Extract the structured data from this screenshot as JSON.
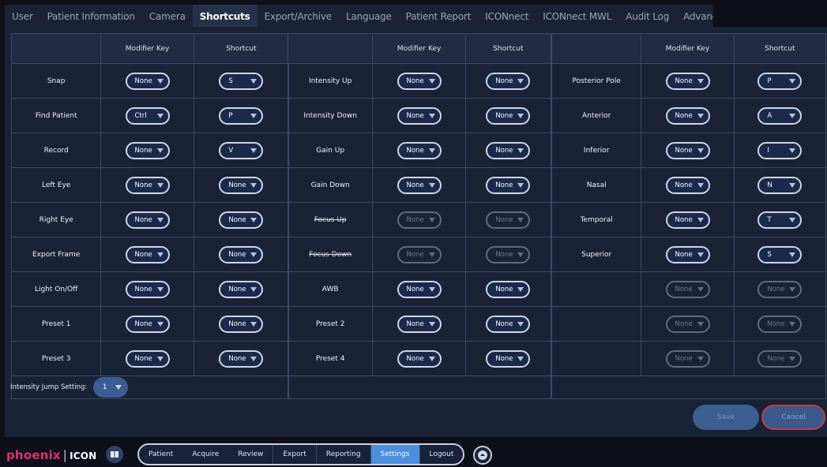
{
  "tabs": [
    {
      "label": "User"
    },
    {
      "label": "Patient Information"
    },
    {
      "label": "Camera"
    },
    {
      "label": "Shortcuts",
      "active": true
    },
    {
      "label": "Export/Archive"
    },
    {
      "label": "Language"
    },
    {
      "label": "Patient Report"
    },
    {
      "label": "ICONnect"
    },
    {
      "label": "ICONnect MWL"
    },
    {
      "label": "Audit Log"
    },
    {
      "label": "Advanced Settings"
    }
  ],
  "headers": {
    "modifier": "Modifier Key",
    "shortcut": "Shortcut"
  },
  "sections": [
    {
      "rows": [
        {
          "name": "Snap",
          "modifier": "None",
          "shortcut": "S"
        },
        {
          "name": "Find Patient",
          "modifier": "Ctrl",
          "shortcut": "P"
        },
        {
          "name": "Record",
          "modifier": "None",
          "shortcut": "V"
        },
        {
          "name": "Left Eye",
          "modifier": "None",
          "shortcut": "None"
        },
        {
          "name": "Right Eye",
          "modifier": "None",
          "shortcut": "None"
        },
        {
          "name": "Export Frame",
          "modifier": "None",
          "shortcut": "None"
        },
        {
          "name": "Light On/Off",
          "modifier": "None",
          "shortcut": "None"
        },
        {
          "name": "Preset 1",
          "modifier": "None",
          "shortcut": "None"
        },
        {
          "name": "Preset 3",
          "modifier": "None",
          "shortcut": "None"
        }
      ]
    },
    {
      "rows": [
        {
          "name": "Intensity Up",
          "modifier": "None",
          "shortcut": "None"
        },
        {
          "name": "Intensity Down",
          "modifier": "None",
          "shortcut": "None"
        },
        {
          "name": "Gain Up",
          "modifier": "None",
          "shortcut": "None"
        },
        {
          "name": "Gain Down",
          "modifier": "None",
          "shortcut": "None"
        },
        {
          "name": "Focus Up",
          "modifier": "None",
          "shortcut": "None",
          "disabled": true
        },
        {
          "name": "Focus Down",
          "modifier": "None",
          "shortcut": "None",
          "disabled": true
        },
        {
          "name": "AWB",
          "modifier": "None",
          "shortcut": "None"
        },
        {
          "name": "Preset 2",
          "modifier": "None",
          "shortcut": "None"
        },
        {
          "name": "Preset 4",
          "modifier": "None",
          "shortcut": "None"
        }
      ]
    },
    {
      "rows": [
        {
          "name": "Posterior Pole",
          "modifier": "None",
          "shortcut": "P"
        },
        {
          "name": "Anterior",
          "modifier": "None",
          "shortcut": "A"
        },
        {
          "name": "Inferior",
          "modifier": "None",
          "shortcut": "I"
        },
        {
          "name": "Nasal",
          "modifier": "None",
          "shortcut": "N"
        },
        {
          "name": "Temporal",
          "modifier": "None",
          "shortcut": "T"
        },
        {
          "name": "Superior",
          "modifier": "None",
          "shortcut": "S"
        },
        {
          "name": "",
          "modifier": "None",
          "shortcut": "None",
          "disabled": true
        },
        {
          "name": "",
          "modifier": "None",
          "shortcut": "None",
          "disabled": true
        },
        {
          "name": "",
          "modifier": "None",
          "shortcut": "None",
          "disabled": true
        }
      ]
    }
  ],
  "intensity": {
    "label": "Intensity Jump Setting:",
    "value": "1"
  },
  "buttons": {
    "save": "Save",
    "cancel": "Cancel"
  },
  "footer": {
    "logo_phoenix": "phoenix",
    "logo_sep": "|",
    "logo_icon": "ICON",
    "nav": [
      {
        "label": "Patient"
      },
      {
        "label": "Acquire"
      },
      {
        "label": "Review"
      },
      {
        "label": "Export"
      },
      {
        "label": "Reporting"
      },
      {
        "label": "Settings",
        "active": true
      },
      {
        "label": "Logout"
      }
    ]
  },
  "colors": {
    "accent": "#4a8fe0",
    "brand": "#e0306e",
    "cancel_border": "#c63a4a"
  }
}
